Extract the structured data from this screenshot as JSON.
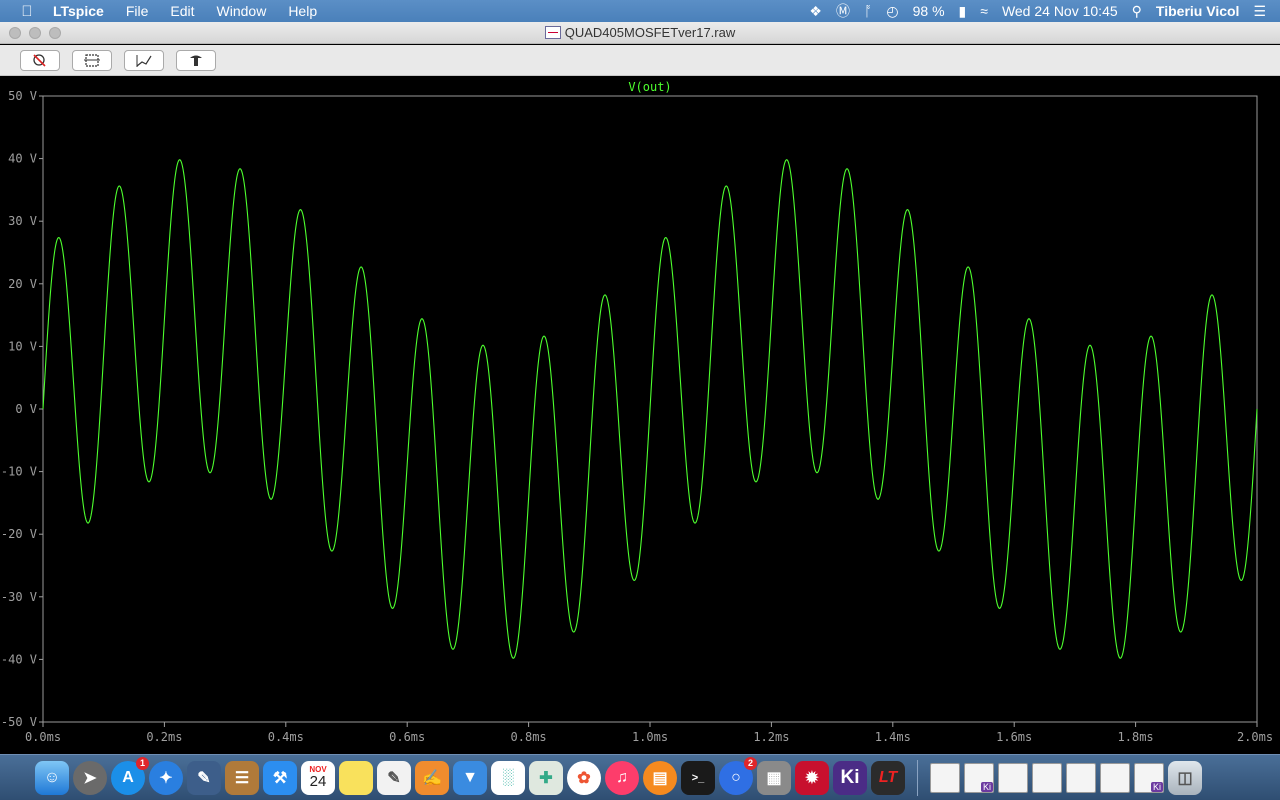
{
  "menubar": {
    "app_name": "LTspice",
    "menus": [
      "File",
      "Edit",
      "Window",
      "Help"
    ],
    "battery": "98 %",
    "datetime": "Wed 24 Nov  10:45",
    "user": "Tiberiu Vicol"
  },
  "window": {
    "title": "QUAD405MOSFETver17.raw"
  },
  "toolbar": {
    "buttons": [
      "zoom-cancel-icon",
      "zoom-area-icon",
      "autorange-icon",
      "pan-icon"
    ]
  },
  "dock": {
    "calendar_month": "NOV",
    "calendar_day": "24",
    "badge_appstore": "1",
    "badge_signal": "2",
    "kicad_label": "Ki",
    "lt_label": "LT",
    "doc_badge": "Ki"
  },
  "chart_data": {
    "type": "line",
    "title": "V(out)",
    "xlabel": "",
    "ylabel": "",
    "xlim": [
      0,
      2.0
    ],
    "ylim": [
      -50,
      50
    ],
    "x_ticks": [
      "0.0ms",
      "0.2ms",
      "0.4ms",
      "0.6ms",
      "0.8ms",
      "1.0ms",
      "1.2ms",
      "1.4ms",
      "1.6ms",
      "1.8ms",
      "2.0ms"
    ],
    "y_ticks": [
      "50 V",
      "40 V",
      "30 V",
      "20 V",
      "10 V",
      "0 V",
      "-10 V",
      "-20 V",
      "-30 V",
      "-40 V",
      "-50 V"
    ],
    "series": [
      {
        "name": "V(out)",
        "color": "#4dff2e",
        "x_unit": "ms",
        "components": [
          {
            "amplitude": 25,
            "frequency_khz": 10
          },
          {
            "amplitude": 15,
            "frequency_khz": 1
          }
        ]
      }
    ],
    "grid": false
  }
}
